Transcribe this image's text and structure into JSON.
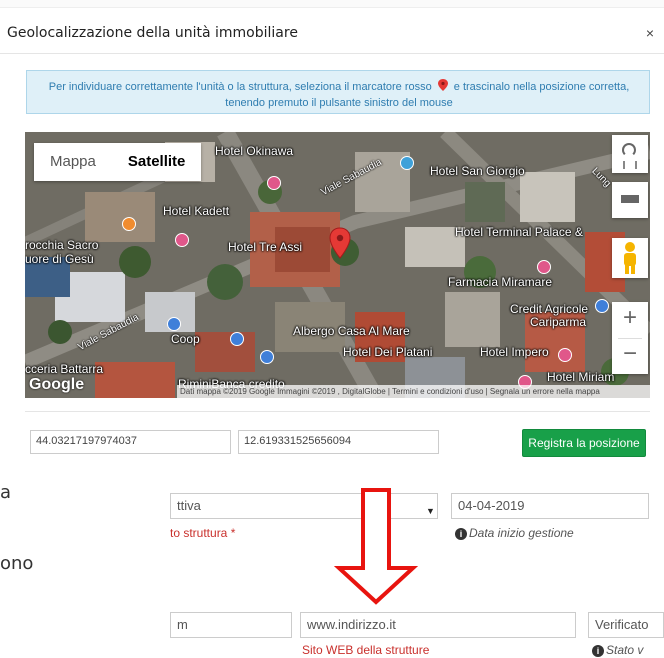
{
  "modal": {
    "title": "Geolocalizzazione della unità immobiliare",
    "close": "×",
    "info_part1": "Per individuare correttamente l'unità o la struttura, seleziona il marcatore rosso",
    "info_part2": "e trascinalo nella posizione corretta,",
    "info_line2": "tenendo premuto il pulsante sinistro del mouse"
  },
  "map": {
    "type_map": "Mappa",
    "type_satellite": "Satellite",
    "labels": {
      "okinawa": "Hotel Okinawa",
      "san_giorgio": "Hotel San Giorgio",
      "kadett": "Hotel Kadett",
      "tre_assi": "Hotel Tre Assi",
      "terminal_palace": "Hotel Terminal Palace &",
      "rocchia1": "rocchia Sacro",
      "rocchia2": "uore di Gesù",
      "farmacia": "Farmacia Miramare",
      "credit1": "Credit Agricole",
      "credit2": "Cariparma",
      "coop": "Coop",
      "albergo": "Albergo Casa Al Mare",
      "platani": "Hotel Dei Platani",
      "impero": "Hotel Impero",
      "battarra": "cceria Battarra",
      "miriam": "Hotel Miriam",
      "rimini_banca": "RiminiBanca credito"
    },
    "streets": {
      "viale_sabaudia_top": "Viale Sabaudia",
      "viale_sabaudia_left": "Viale Sabaudia",
      "lungomare": "Lung"
    },
    "google": "Google",
    "attribution": "Dati mappa ©2019 Google Immagini ©2019 , DigitalGlobe  |  Termini e condizioni d'uso  |  Segnala un errore nella mappa",
    "zoom_in": "+",
    "zoom_out": "−"
  },
  "coordinates": {
    "lat": "44.03217197974037",
    "lng": "12.619331525656094"
  },
  "save_button": "Registra la posizione",
  "form": {
    "select_value": "ttiva",
    "select_label": "to struttura *",
    "date_value": "04-04-2019",
    "date_help": "Data inizio gestione",
    "email_value": "m",
    "web_value": "www.indirizzo.it",
    "web_label": "Sito WEB della strutture",
    "verify_value": "Verificato",
    "status_help": "Stato v"
  },
  "background": {
    "text1": "a",
    "text2": "ono"
  },
  "colors": {
    "accent_green": "#18a049",
    "info_bg": "#dff0f8",
    "info_text": "#2f7db0",
    "pin_red": "#e53935",
    "arrow_red": "#e8140f",
    "error_red": "#c9302c"
  },
  "icons": {
    "pin": "map-pin-icon",
    "pegman": "pegman-icon",
    "fullscreen": "fullscreen-icon",
    "rotate": "rotate-icon",
    "tilt": "tilt-icon",
    "info": "info-circle-icon",
    "arrow": "down-arrow-icon"
  }
}
